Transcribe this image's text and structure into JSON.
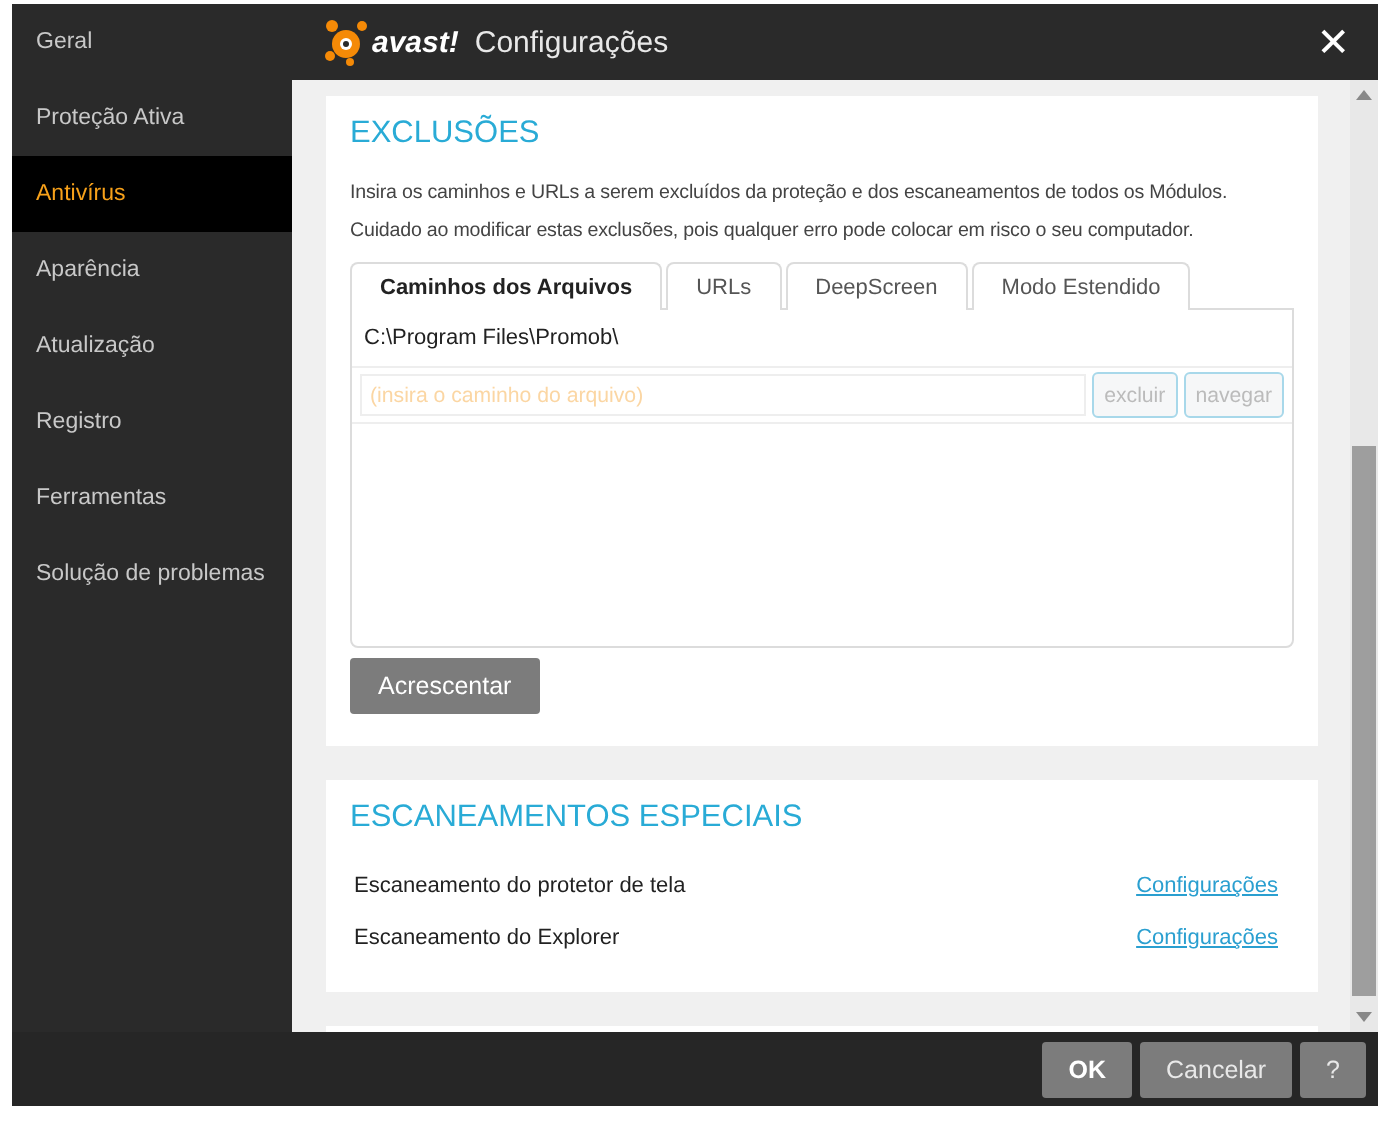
{
  "sidebar": {
    "items": [
      {
        "label": "Geral",
        "selected": false
      },
      {
        "label": "Proteção Ativa",
        "selected": false
      },
      {
        "label": "Antivírus",
        "selected": true
      },
      {
        "label": "Aparência",
        "selected": false
      },
      {
        "label": "Atualização",
        "selected": false
      },
      {
        "label": "Registro",
        "selected": false
      },
      {
        "label": "Ferramentas",
        "selected": false
      },
      {
        "label": "Solução de problemas",
        "selected": false
      }
    ]
  },
  "header": {
    "logo": "avast!",
    "title": "Configurações",
    "close": "✕"
  },
  "exclusions": {
    "title": "EXCLUSÕES",
    "description": "Insira os caminhos e URLs a serem excluídos da proteção e dos escaneamentos de todos os Módulos. Cuidado ao modificar estas exclusões, pois qualquer erro pode colocar em risco o seu computador.",
    "tabs": [
      {
        "label": "Caminhos dos Arquivos",
        "selected": true
      },
      {
        "label": "URLs",
        "selected": false
      },
      {
        "label": "DeepScreen",
        "selected": false
      },
      {
        "label": "Modo Estendido",
        "selected": false
      }
    ],
    "paths": [
      "C:\\Program Files\\Promob\\"
    ],
    "new_path": {
      "placeholder": "(insira o caminho do arquivo)"
    },
    "row_buttons": [
      {
        "label": "excluir",
        "disabled": true
      },
      {
        "label": "navegar",
        "disabled": true
      }
    ],
    "add_button": "Acrescentar"
  },
  "special_scans": {
    "title": "ESCANEAMENTOS ESPECIAIS",
    "rows": [
      {
        "label": "Escaneamento do protetor de tela",
        "link": "Configurações"
      },
      {
        "label": "Escaneamento do Explorer",
        "link": "Configurações"
      }
    ]
  },
  "footer": {
    "buttons": [
      {
        "label": "OK",
        "kind": "primary"
      },
      {
        "label": "Cancelar",
        "kind": "normal"
      },
      {
        "label": "?",
        "kind": "normal"
      }
    ]
  }
}
